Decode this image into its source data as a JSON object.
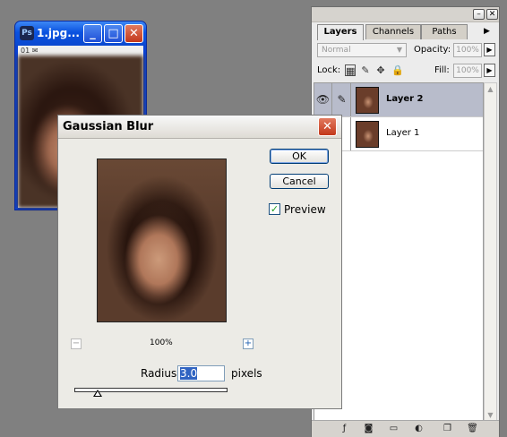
{
  "doc_window": {
    "title": "1.jpg...",
    "zoom_strip": "01",
    "minimize_glyph": "_",
    "maximize_glyph": "□",
    "close_glyph": "✕"
  },
  "layers_panel": {
    "tabs": [
      {
        "label": "Layers",
        "active": true
      },
      {
        "label": "Channels",
        "active": false
      },
      {
        "label": "Paths",
        "active": false
      }
    ],
    "blend_mode": "Normal",
    "opacity_label": "Opacity:",
    "opacity_value": "100%",
    "lock_label": "Lock:",
    "fill_label": "Fill:",
    "fill_value": "100%",
    "layers": [
      {
        "name": "Layer 2",
        "selected": true
      },
      {
        "name": "Layer 1",
        "selected": false
      }
    ]
  },
  "blur_dialog": {
    "title": "Gaussian Blur",
    "ok_label": "OK",
    "cancel_label": "Cancel",
    "preview_label": "Preview",
    "preview_checked": true,
    "zoom_percent": "100%",
    "zoom_out_glyph": "−",
    "zoom_in_glyph": "+",
    "radius_label": "Radius:",
    "radius_value": "3.0",
    "radius_unit": "pixels",
    "radius_slider_fraction": 0.15
  },
  "colors": {
    "xp_title_blue": "#0a52e0",
    "xp_close_red": "#c3381b",
    "desktop_gray": "#808080",
    "dialog_face": "#ecebe6",
    "selected_layer": "#b8bccb"
  }
}
